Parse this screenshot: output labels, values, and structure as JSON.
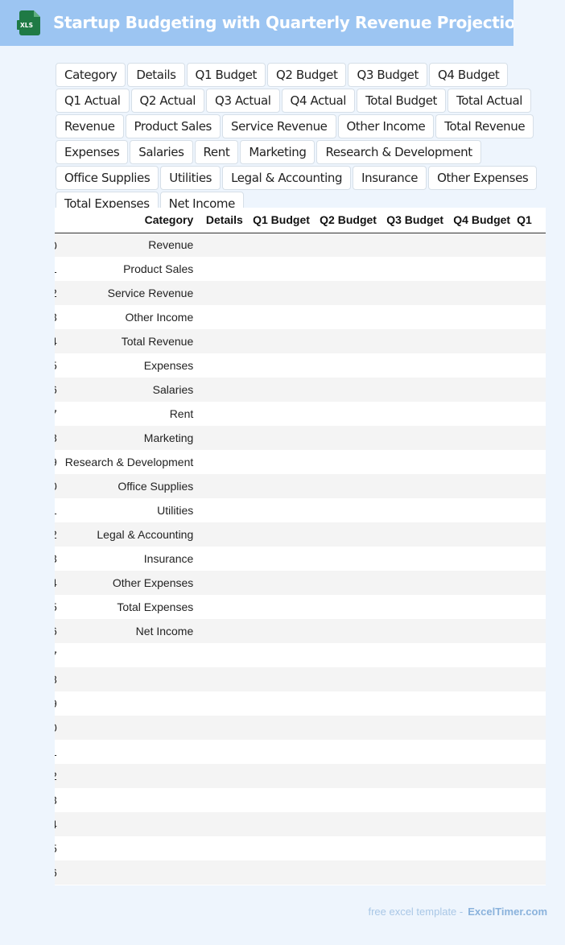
{
  "header": {
    "title": "Startup Budgeting with Quarterly Revenue Projection Sheets",
    "icon_label": "XLS",
    "icon_color": "#1f7a45"
  },
  "tags": [
    "Category",
    "Details",
    "Q1 Budget",
    "Q2 Budget",
    "Q3 Budget",
    "Q4 Budget",
    "Q1 Actual",
    "Q2 Actual",
    "Q3 Actual",
    "Q4 Actual",
    "Total Budget",
    "Total Actual",
    "Revenue",
    "Product Sales",
    "Service Revenue",
    "Other Income",
    "Total Revenue",
    "Expenses",
    "Salaries",
    "Rent",
    "Marketing",
    "Research & Development",
    "Office Supplies",
    "Utilities",
    "Legal & Accounting",
    "Insurance",
    "Other Expenses",
    "Total Expenses",
    "Net Income"
  ],
  "table": {
    "columns": [
      "Category",
      "Details",
      "Q1 Budget",
      "Q2 Budget",
      "Q3 Budget",
      "Q4 Budget",
      "Q1"
    ],
    "rows": [
      {
        "idx": "0",
        "category": "Revenue"
      },
      {
        "idx": "1",
        "category": "Product Sales"
      },
      {
        "idx": "2",
        "category": "Service Revenue"
      },
      {
        "idx": "3",
        "category": "Other Income"
      },
      {
        "idx": "4",
        "category": "Total Revenue"
      },
      {
        "idx": "5",
        "category": "Expenses"
      },
      {
        "idx": "6",
        "category": "Salaries"
      },
      {
        "idx": "7",
        "category": "Rent"
      },
      {
        "idx": "8",
        "category": "Marketing"
      },
      {
        "idx": "9",
        "category": "Research & Development"
      },
      {
        "idx": "0",
        "category": "Office Supplies"
      },
      {
        "idx": "1",
        "category": "Utilities"
      },
      {
        "idx": "2",
        "category": "Legal & Accounting"
      },
      {
        "idx": "3",
        "category": "Insurance"
      },
      {
        "idx": "4",
        "category": "Other Expenses"
      },
      {
        "idx": "5",
        "category": "Total Expenses"
      },
      {
        "idx": "6",
        "category": "Net Income"
      },
      {
        "idx": "7",
        "category": ""
      },
      {
        "idx": "8",
        "category": ""
      },
      {
        "idx": "9",
        "category": ""
      },
      {
        "idx": "0",
        "category": ""
      },
      {
        "idx": "1",
        "category": ""
      },
      {
        "idx": "2",
        "category": ""
      },
      {
        "idx": "3",
        "category": ""
      },
      {
        "idx": "4",
        "category": ""
      },
      {
        "idx": "5",
        "category": ""
      },
      {
        "idx": "6",
        "category": ""
      }
    ]
  },
  "footer": {
    "prefix": "free excel template -",
    "brand": "ExcelTimer.com"
  }
}
